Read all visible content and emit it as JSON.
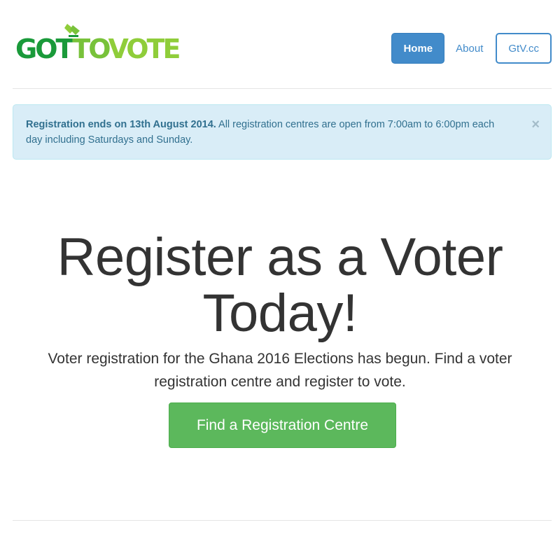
{
  "header": {
    "logo": {
      "part1": "GOT",
      "part2": "TO",
      "part3": "VOTE"
    },
    "nav": {
      "home": "Home",
      "about": "About",
      "gtv": "GtV.cc"
    }
  },
  "alert": {
    "strong": "Registration ends on 13th August 2014.",
    "text": " All registration centres are open from 7:00am to 6:00pm each day including Saturdays and Sunday.",
    "close": "×"
  },
  "hero": {
    "title_line1": "Register as a Voter",
    "title_line2": "Today!",
    "lead": "Voter registration for the Ghana 2016 Elections has begun. Find a voter registration centre and register to vote.",
    "cta": "Find a Registration Centre"
  },
  "colors": {
    "primary": "#428bca",
    "success": "#5cb85c",
    "alert_bg": "#d9edf7",
    "alert_text": "#31708f",
    "logo_dark_green": "#1a9a3a",
    "logo_light_green": "#8fcd3a"
  }
}
